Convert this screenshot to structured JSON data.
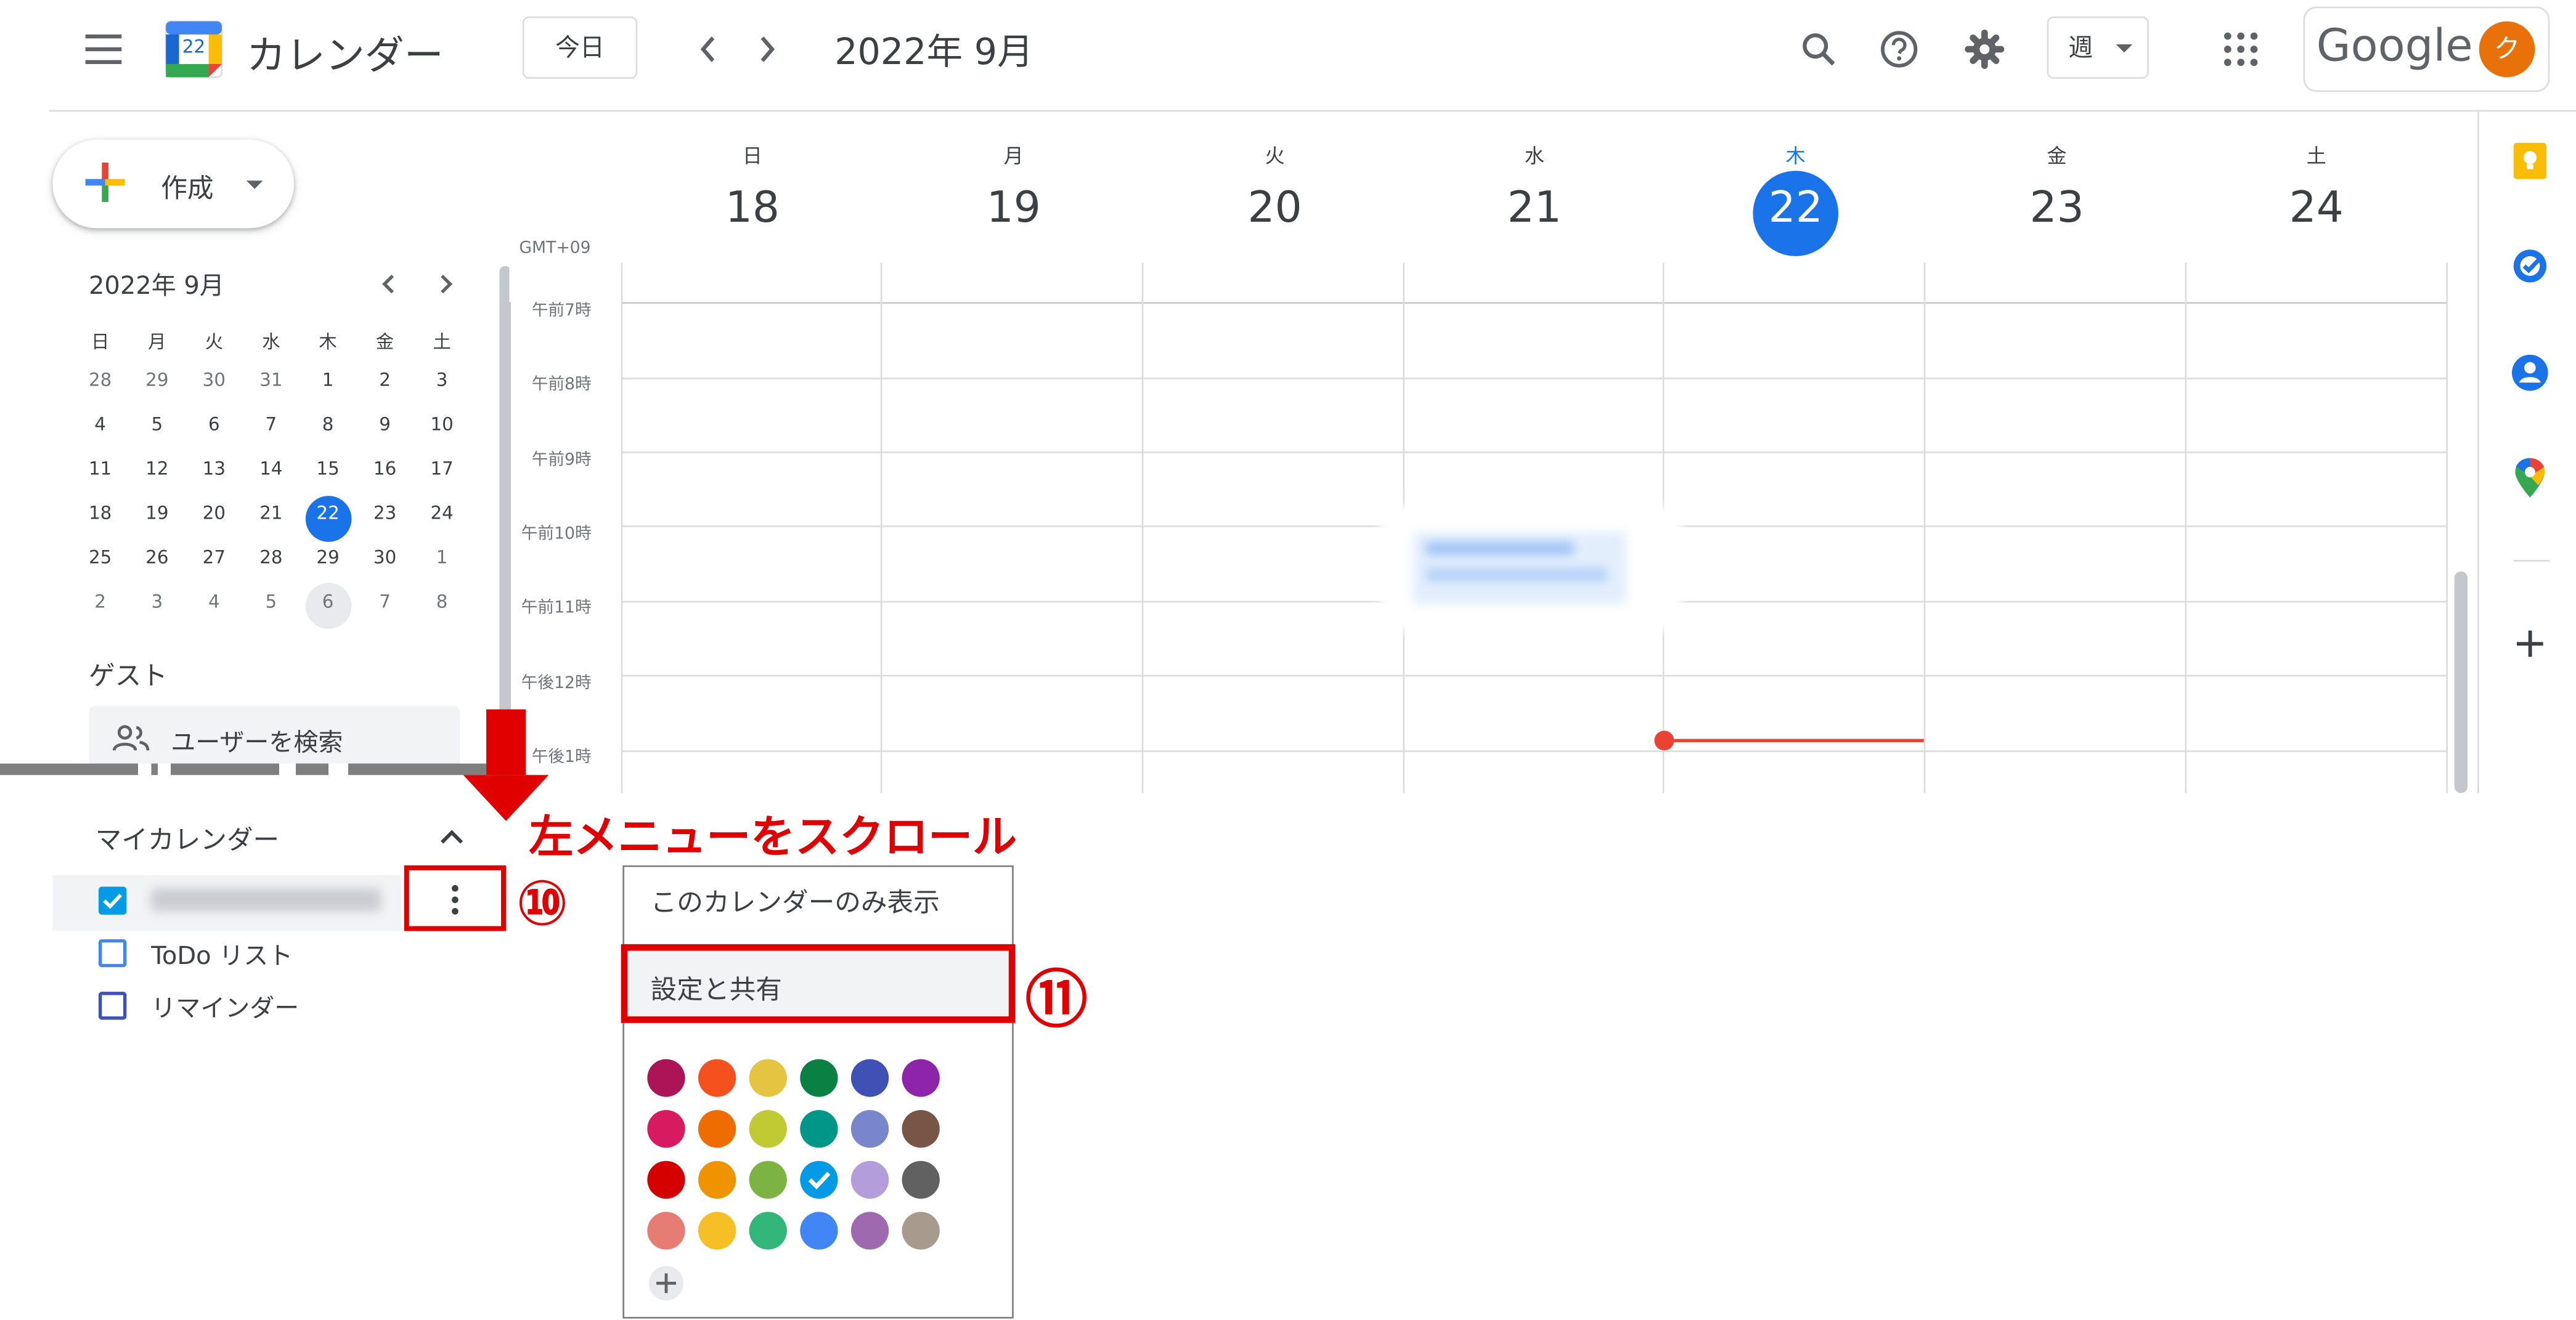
{
  "header": {
    "app_name": "カレンダー",
    "app_icon_day": "22",
    "today_button": "今日",
    "month_title": "2022年 9月",
    "view_selector": "週",
    "google_logo": "Google",
    "avatar_letter": "ク",
    "icons": [
      "menu-icon",
      "calendar-app-icon",
      "chevron-left-icon",
      "chevron-right-icon",
      "search-icon",
      "help-icon",
      "settings-icon",
      "dropdown-caret-icon",
      "apps-grid-icon"
    ]
  },
  "sidebar": {
    "create_label": "作成",
    "mini_calendar": {
      "title": "2022年 9月",
      "weekdays": [
        "日",
        "月",
        "火",
        "水",
        "木",
        "金",
        "土"
      ],
      "weeks": [
        [
          "28",
          "29",
          "30",
          "31",
          "1",
          "2",
          "3"
        ],
        [
          "4",
          "5",
          "6",
          "7",
          "8",
          "9",
          "10"
        ],
        [
          "11",
          "12",
          "13",
          "14",
          "15",
          "16",
          "17"
        ],
        [
          "18",
          "19",
          "20",
          "21",
          "22",
          "23",
          "24"
        ],
        [
          "25",
          "26",
          "27",
          "28",
          "29",
          "30",
          "1"
        ],
        [
          "2",
          "3",
          "4",
          "5",
          "6",
          "7",
          "8"
        ]
      ],
      "selected": "22"
    },
    "guest_title": "ゲスト",
    "search_placeholder": "ユーザーを検索",
    "my_calendars_title": "マイカレンダー",
    "calendars": [
      {
        "label": "",
        "checked": true,
        "color": "#039be5"
      },
      {
        "label": "ToDo リスト",
        "checked": false,
        "color": "#4285f4"
      },
      {
        "label": "リマインダー",
        "checked": false,
        "color": "#3f51b5"
      }
    ]
  },
  "week_view": {
    "timezone": "GMT+09",
    "days": [
      {
        "dow": "日",
        "date": "18"
      },
      {
        "dow": "月",
        "date": "19"
      },
      {
        "dow": "火",
        "date": "20"
      },
      {
        "dow": "水",
        "date": "21"
      },
      {
        "dow": "木",
        "date": "22",
        "today": true
      },
      {
        "dow": "金",
        "date": "23"
      },
      {
        "dow": "土",
        "date": "24"
      }
    ],
    "time_labels": [
      "午前7時",
      "午前8時",
      "午前9時",
      "午前10時",
      "午前11時",
      "午後12時",
      "午後1時"
    ]
  },
  "right_rail": {
    "icons": [
      "keep-icon",
      "tasks-icon",
      "contacts-icon",
      "maps-icon",
      "add-icon"
    ]
  },
  "annotations": {
    "scroll_note": "左メニューをスクロール",
    "step10": "⑩",
    "step11": "⑪"
  },
  "options_menu": {
    "display_only": "このカレンダーのみ表示",
    "settings_share": "設定と共有",
    "colors": [
      [
        "#ad1457",
        "#f4511e",
        "#e4c441",
        "#0b8043",
        "#3f51b5",
        "#8e24aa"
      ],
      [
        "#d81b60",
        "#ef6c00",
        "#c0ca33",
        "#009688",
        "#7986cb",
        "#795548"
      ],
      [
        "#d50000",
        "#f09300",
        "#7cb342",
        "#039be5",
        "#b39ddb",
        "#616161"
      ],
      [
        "#e67c73",
        "#f6bf26",
        "#33b679",
        "#4285f4",
        "#9e69af",
        "#a79b8e"
      ]
    ],
    "selected_color": "#039be5"
  }
}
